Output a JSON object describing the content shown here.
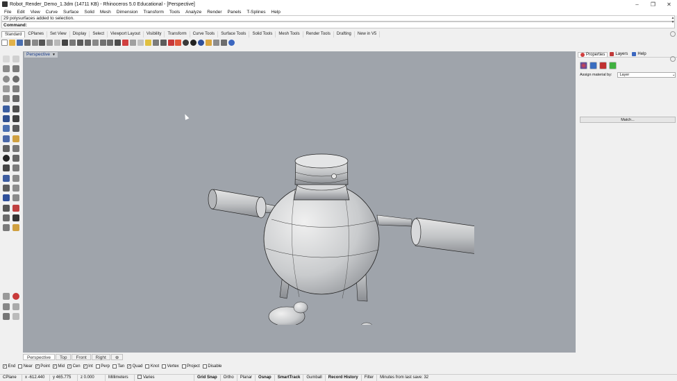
{
  "window": {
    "title": "Robot_Render_Demo_1.3dm (14711 KB) - Rhinoceros 5.0 Educational - [Perspective]",
    "minimize": "–",
    "restore": "❐",
    "close": "✕"
  },
  "menu": [
    "File",
    "Edit",
    "View",
    "Curve",
    "Surface",
    "Solid",
    "Mesh",
    "Dimension",
    "Transform",
    "Tools",
    "Analyze",
    "Render",
    "Panels",
    "T-Splines",
    "Help"
  ],
  "command": {
    "history": "29 polysurfaces added to selection.",
    "prompt": "Command:"
  },
  "toolbar_tabs": [
    "Standard",
    "CPlanes",
    "Set View",
    "Display",
    "Select",
    "Viewport Layout",
    "Visibility",
    "Transform",
    "Curve Tools",
    "Surface Tools",
    "Solid Tools",
    "Mesh Tools",
    "Render Tools",
    "Drafting",
    "New in V5"
  ],
  "viewport": {
    "label": "Perspective",
    "caret": "▼"
  },
  "right_panel": {
    "tabs": [
      "Properties",
      "Layers",
      "Help"
    ],
    "assign_label": "Assign material by:",
    "assign_value": "Layer",
    "match_button": "Match..."
  },
  "viewport_tabs": [
    "Perspective",
    "Top",
    "Front",
    "Right",
    "⊕"
  ],
  "osnaps": [
    {
      "label": "End",
      "checked": true
    },
    {
      "label": "Near",
      "checked": false
    },
    {
      "label": "Point",
      "checked": true
    },
    {
      "label": "Mid",
      "checked": true
    },
    {
      "label": "Cen",
      "checked": true
    },
    {
      "label": "Int",
      "checked": true
    },
    {
      "label": "Perp",
      "checked": false
    },
    {
      "label": "Tan",
      "checked": false
    },
    {
      "label": "Quad",
      "checked": true
    },
    {
      "label": "Knot",
      "checked": false
    },
    {
      "label": "Vertex",
      "checked": false
    },
    {
      "label": "Project",
      "checked": false
    },
    {
      "label": "Disable",
      "checked": false
    }
  ],
  "status": {
    "cplane": "CPlane",
    "x": "x -612.440",
    "y": "y 465.775",
    "z": "z 0.000",
    "units": "Millimeters",
    "layer": "Varies",
    "grid_snap": "Grid Snap",
    "ortho": "Ortho",
    "planar": "Planar",
    "osnap": "Osnap",
    "smarttrack": "SmartTrack",
    "gumball": "Gumball",
    "record_history": "Record History",
    "filter": "Filter",
    "save_info": "Minutes from last save: 32"
  },
  "colors": {
    "viewport_bg": "#9fa4ab",
    "model_fill": "#c9cbcd"
  }
}
